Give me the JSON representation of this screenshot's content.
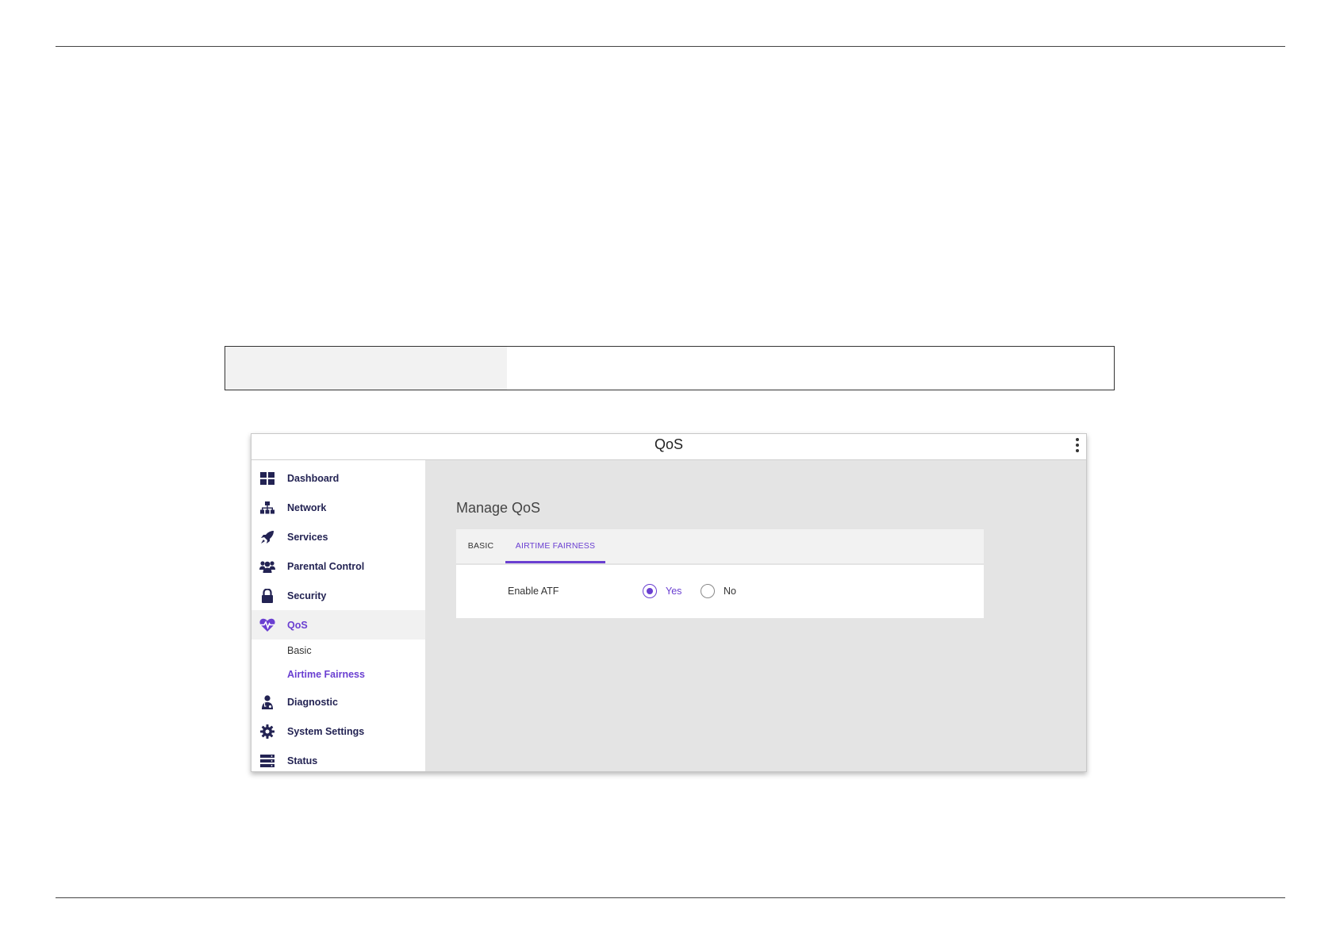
{
  "window": {
    "title": "QoS"
  },
  "sidebar": {
    "items": [
      {
        "label": "Dashboard",
        "icon": "dashboard-icon"
      },
      {
        "label": "Network",
        "icon": "network-icon"
      },
      {
        "label": "Services",
        "icon": "rocket-icon"
      },
      {
        "label": "Parental Control",
        "icon": "users-icon"
      },
      {
        "label": "Security",
        "icon": "lock-icon"
      },
      {
        "label": "QoS",
        "icon": "heartbeat-icon",
        "active": true
      },
      {
        "label": "Diagnostic",
        "icon": "doctor-icon"
      },
      {
        "label": "System Settings",
        "icon": "gear-icon"
      },
      {
        "label": "Status",
        "icon": "server-icon"
      }
    ],
    "qos_subitems": [
      {
        "label": "Basic"
      },
      {
        "label": "Airtime Fairness",
        "active": true
      }
    ]
  },
  "main": {
    "heading": "Manage QoS",
    "tabs": [
      {
        "label": "BASIC"
      },
      {
        "label": "AIRTIME FAIRNESS",
        "active": true
      }
    ],
    "enable_atf": {
      "label": "Enable ATF",
      "options": [
        "Yes",
        "No"
      ],
      "selected": "Yes"
    }
  },
  "colors": {
    "accent": "#6a3fd1",
    "nav_text": "#232353",
    "content_bg": "#e4e4e4"
  }
}
